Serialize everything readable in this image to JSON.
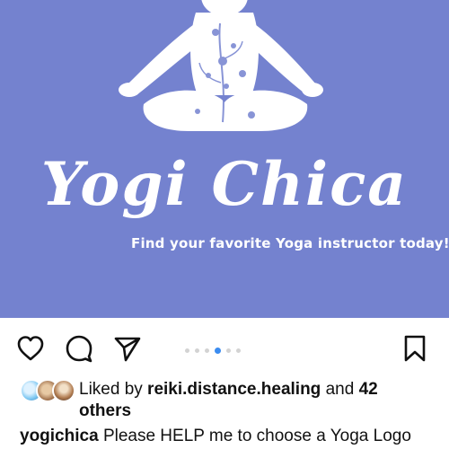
{
  "post": {
    "brand_title": "Yogi Chica",
    "tagline": "Find your favorite Yoga instructor today!",
    "background_color": "#7482cf"
  },
  "actions": {
    "like_icon": "heart-icon",
    "comment_icon": "comment-bubble-icon",
    "share_icon": "paper-plane-icon",
    "save_icon": "bookmark-icon"
  },
  "carousel": {
    "total_dots": 6,
    "active_index": 3,
    "active_color": "#3b8cf0"
  },
  "likes": {
    "prefix": "Liked by ",
    "user": "reiki.distance.healing",
    "middle": " and ",
    "count": "42",
    "suffix": "others"
  },
  "caption": {
    "username": "yogichica",
    "text": "Please HELP me to choose a Yoga Logo"
  }
}
